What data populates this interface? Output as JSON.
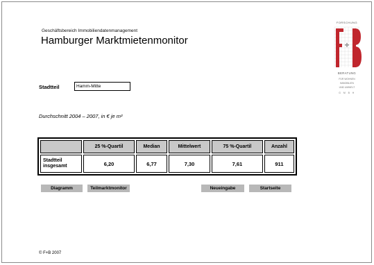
{
  "header": {
    "department": "Geschäftsbereich Immobiliendatenmanagement",
    "title": "Hamburger Marktmietenmonitor"
  },
  "logo": {
    "top_text": "FORSCHUNG",
    "letters": "F+B",
    "bottom_lines": [
      "BERATUNG",
      "FÜR WOHNEN",
      "IMMOBILIEN",
      "UND UMWELT",
      "G M B H"
    ],
    "brand_color": "#c0262d"
  },
  "district": {
    "label": "Stadtteil",
    "value": "Hamm-Mitte"
  },
  "average_note": "Durchschnitt 2004 – 2007, in € je m²",
  "table": {
    "headers": [
      "",
      "25 %-Quartil",
      "Median",
      "Mittelwert",
      "75 %-Quartil",
      "Anzahl"
    ],
    "row": {
      "label_line1": "Stadtteil",
      "label_line2": "insgesamt",
      "values": [
        "6,20",
        "6,77",
        "7,30",
        "7,61",
        "911"
      ]
    }
  },
  "buttons": {
    "diagramm": "Diagramm",
    "teilmarkt": "Teilmarktmonitor",
    "neueingabe": "Neueingabe",
    "startseite": "Startseite"
  },
  "footer": {
    "copyright": "© F+B 2007"
  }
}
